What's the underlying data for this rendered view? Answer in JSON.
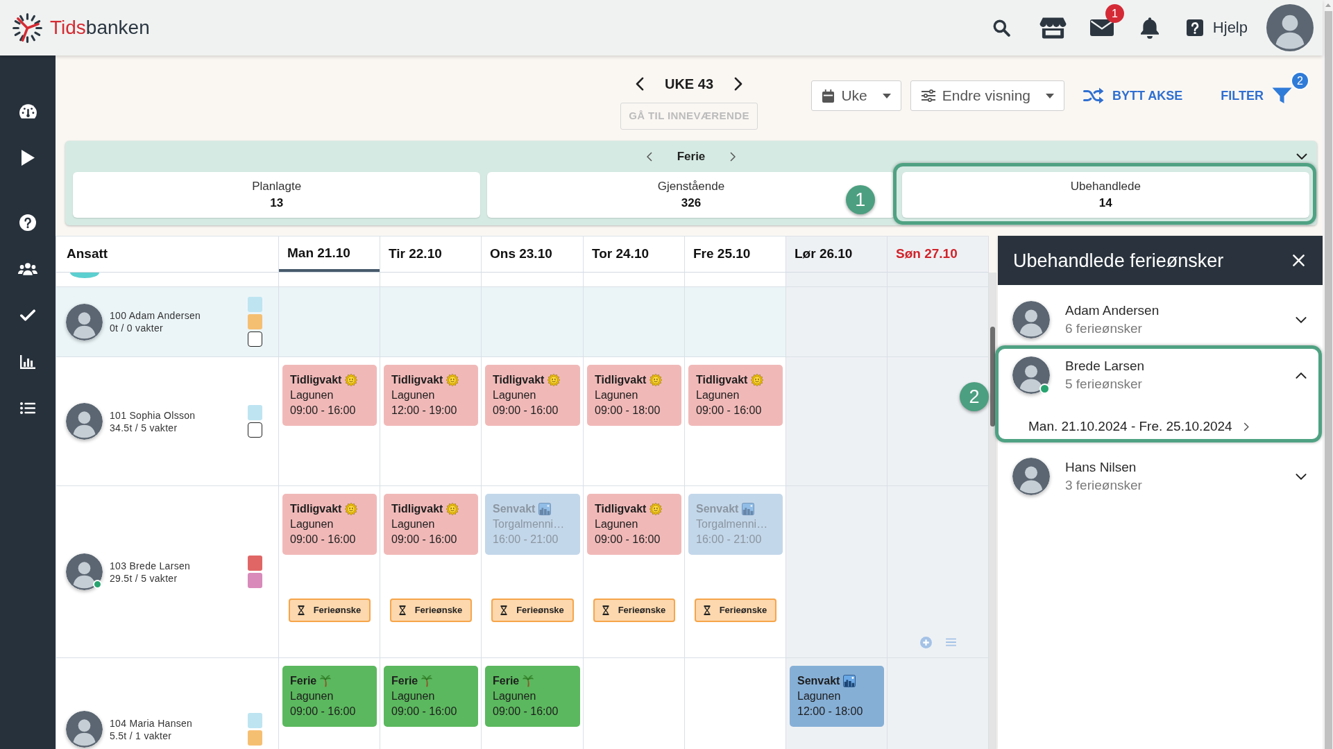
{
  "header": {
    "logo": [
      {
        "text": "Tids",
        "color": "#d52b33"
      },
      {
        "text": "banken",
        "color": "#2b3742"
      }
    ],
    "icons": [
      {
        "kind": "search"
      },
      {
        "kind": "store"
      },
      {
        "kind": "mail",
        "badge": "1"
      },
      {
        "kind": "bell"
      }
    ],
    "help": {
      "label": "Hjelp"
    }
  },
  "sidebar": {
    "groups": [
      {
        "items": [
          {
            "kind": "dashboard"
          },
          {
            "kind": "play"
          }
        ]
      },
      {
        "items": [
          {
            "kind": "help"
          },
          {
            "kind": "users"
          },
          {
            "kind": "check"
          },
          {
            "kind": "chart"
          },
          {
            "kind": "list"
          }
        ]
      }
    ]
  },
  "toolbar": {
    "week": "UKE 43",
    "today_button": {
      "label": "GÅ TIL INNEVÆRENDE",
      "disabled": true
    },
    "selects": [
      {
        "kind": "calendar",
        "value": "Uke"
      },
      {
        "kind": "sliders",
        "value": "Endre visning"
      }
    ],
    "swap_axis": {
      "label": "BYTT AKSE"
    },
    "filter": {
      "label": "FILTER",
      "badge": "2"
    }
  },
  "vacation_panel": {
    "title": "Ferie",
    "stats": [
      {
        "label": "Planlagte",
        "value": "13",
        "highlighted": false
      },
      {
        "label": "Gjenstående",
        "value": "326",
        "highlighted": false
      },
      {
        "label": "Ubehandlede",
        "value": "14",
        "highlighted": true,
        "callout": "1"
      }
    ]
  },
  "schedule": {
    "employee_header": "Ansatt",
    "days": [
      {
        "label": "Man 21.10",
        "kind": "weekday",
        "selected": true
      },
      {
        "label": "Tir 22.10",
        "kind": "weekday",
        "selected": false
      },
      {
        "label": "Ons 23.10",
        "kind": "weekday",
        "selected": false
      },
      {
        "label": "Tor 24.10",
        "kind": "weekday",
        "selected": false
      },
      {
        "label": "Fre 25.10",
        "kind": "weekday",
        "selected": false
      },
      {
        "label": "Lør 26.10",
        "kind": "saturday",
        "selected": false
      },
      {
        "label": "Søn 27.10",
        "kind": "sunday",
        "selected": false
      }
    ],
    "rows": [
      {
        "kind": "clipped",
        "selected": false
      },
      {
        "kind": "employee",
        "name": "100 Adam Andersen",
        "hours": "0t / 0 vakter",
        "selected": true,
        "online": false,
        "markers": [
          {
            "kind": "swatch",
            "color": "#bee4f1"
          },
          {
            "kind": "swatch",
            "color": "#f5bf72"
          },
          {
            "kind": "checkbox",
            "checked": false
          }
        ],
        "cells": [
          {},
          {},
          {},
          {},
          {},
          {},
          {}
        ]
      },
      {
        "kind": "employee",
        "name": "101 Sophia Olsson",
        "hours": "34.5t / 5 vakter",
        "selected": false,
        "online": false,
        "markers": [
          {
            "kind": "swatch",
            "color": "#bee4f1"
          },
          {
            "kind": "checkbox",
            "checked": false
          }
        ],
        "cells": [
          {
            "shifts": [
              {
                "kind": "early",
                "title": "Tidligvakt",
                "place": "Lagunen",
                "time": "09:00 - 16:00",
                "dimmed": false
              }
            ]
          },
          {
            "shifts": [
              {
                "kind": "early",
                "title": "Tidligvakt",
                "place": "Lagunen",
                "time": "12:00 - 19:00",
                "dimmed": false
              }
            ]
          },
          {
            "shifts": [
              {
                "kind": "early",
                "title": "Tidligvakt",
                "place": "Lagunen",
                "time": "09:00 - 16:00",
                "dimmed": false
              }
            ]
          },
          {
            "shifts": [
              {
                "kind": "early",
                "title": "Tidligvakt",
                "place": "Lagunen",
                "time": "09:00 - 18:00",
                "dimmed": false
              }
            ]
          },
          {
            "shifts": [
              {
                "kind": "early",
                "title": "Tidligvakt",
                "place": "Lagunen",
                "time": "09:00 - 16:00",
                "dimmed": false
              }
            ]
          },
          {},
          {}
        ]
      },
      {
        "kind": "employee",
        "name": "103 Brede Larsen",
        "hours": "29.5t / 5 vakter",
        "selected": false,
        "online": true,
        "markers": [
          {
            "kind": "swatch",
            "color": "#e06666"
          },
          {
            "kind": "swatch",
            "color": "#d98abb"
          }
        ],
        "cells": [
          {
            "shifts": [
              {
                "kind": "early",
                "title": "Tidligvakt",
                "place": "Lagunen",
                "time": "09:00 - 16:00",
                "dimmed": false
              }
            ],
            "requests": [
              {
                "label": "Ferieønske"
              }
            ]
          },
          {
            "shifts": [
              {
                "kind": "early",
                "title": "Tidligvakt",
                "place": "Lagunen",
                "time": "09:00 - 16:00",
                "dimmed": false
              }
            ],
            "requests": [
              {
                "label": "Ferieønske"
              }
            ]
          },
          {
            "shifts": [
              {
                "kind": "late",
                "title": "Senvakt",
                "place": "Torgalmenni…",
                "time": "16:00 - 21:00",
                "dimmed": true
              }
            ],
            "requests": [
              {
                "label": "Ferieønske"
              }
            ]
          },
          {
            "shifts": [
              {
                "kind": "early",
                "title": "Tidligvakt",
                "place": "Lagunen",
                "time": "09:00 - 16:00",
                "dimmed": false
              }
            ],
            "requests": [
              {
                "label": "Ferieønske"
              }
            ]
          },
          {
            "shifts": [
              {
                "kind": "late",
                "title": "Senvakt",
                "place": "Torgalmenni…",
                "time": "16:00 - 21:00",
                "dimmed": true
              }
            ],
            "requests": [
              {
                "label": "Ferieønske"
              }
            ]
          },
          {},
          {
            "tools": true
          }
        ]
      },
      {
        "kind": "employee",
        "name": "104 Maria Hansen",
        "hours": "5.5t / 1 vakter",
        "selected": false,
        "online": false,
        "markers": [
          {
            "kind": "swatch",
            "color": "#bee4f1"
          },
          {
            "kind": "swatch",
            "color": "#f5bf72"
          }
        ],
        "cells": [
          {
            "shifts": [
              {
                "kind": "vacation",
                "title": "Ferie",
                "place": "Lagunen",
                "time": "09:00 - 16:00",
                "dimmed": false
              }
            ]
          },
          {
            "shifts": [
              {
                "kind": "vacation",
                "title": "Ferie",
                "place": "Lagunen",
                "time": "09:00 - 16:00",
                "dimmed": false
              }
            ]
          },
          {
            "shifts": [
              {
                "kind": "vacation",
                "title": "Ferie",
                "place": "Lagunen",
                "time": "09:00 - 16:00",
                "dimmed": false
              }
            ]
          },
          {},
          {},
          {
            "shifts": [
              {
                "kind": "late",
                "title": "Senvakt",
                "place": "Lagunen",
                "time": "12:00 - 18:00",
                "dimmed": false
              }
            ]
          },
          {}
        ]
      }
    ]
  },
  "requests_panel": {
    "title": "Ubehandlede ferieønsker",
    "items": [
      {
        "name": "Adam Andersen",
        "count": "6 ferieønsker",
        "online": false,
        "expanded": false,
        "highlighted": false
      },
      {
        "name": "Brede Larsen",
        "count": "5 ferieønsker",
        "online": true,
        "expanded": true,
        "highlighted": true,
        "callout": "2",
        "periods": [
          "Man. 21.10.2024 - Fre. 25.10.2024"
        ]
      },
      {
        "name": "Hans Nilsen",
        "count": "3 ferieønsker",
        "online": false,
        "expanded": false,
        "highlighted": false
      }
    ]
  }
}
